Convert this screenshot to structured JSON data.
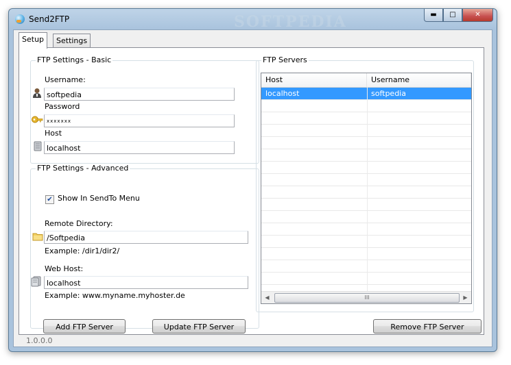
{
  "window": {
    "title": "Send2FTP",
    "minimize_glyph": "▬",
    "maximize_glyph": "□",
    "close_glyph": "✕",
    "watermark": "SOFTPEDIA"
  },
  "tabs": [
    {
      "label": "Setup",
      "active": true
    },
    {
      "label": "Settings",
      "active": false
    }
  ],
  "basic": {
    "group_title": "FTP Settings - Basic",
    "username_label": "Username:",
    "username_value": "softpedia",
    "password_label": "Password",
    "password_value": "xxxxxxx",
    "host_label": "Host",
    "host_value": "localhost"
  },
  "advanced": {
    "group_title": "FTP Settings - Advanced",
    "show_in_sendto_label": "Show In SendTo Menu",
    "show_in_sendto_checked": "✔",
    "remote_dir_label": "Remote Directory:",
    "remote_dir_value": "/Softpedia",
    "remote_dir_example": "Example: /dir1/dir2/",
    "web_host_label": "Web Host:",
    "web_host_value": "localhost",
    "web_host_example": "Example: www.myname.myhoster.de"
  },
  "servers": {
    "group_title": "FTP Servers",
    "columns": [
      "Host",
      "Username"
    ],
    "rows": [
      {
        "host": "localhost",
        "username": "softpedia",
        "selected": true
      }
    ],
    "scroll_left": "◀",
    "scroll_right": "▶",
    "scroll_grip": "III"
  },
  "buttons": {
    "add": "Add FTP Server",
    "update": "Update FTP Server",
    "remove": "Remove FTP Server"
  },
  "version": "1.0.0.0",
  "icons": {
    "app": "app-globe-icon",
    "username": "user-icon",
    "password": "key-icon",
    "host": "server-icon",
    "remote_dir": "folder-icon",
    "web_host": "server-icon"
  },
  "colors": {
    "selection": "#3399ff",
    "title_bar": "#a9c3dd",
    "close_button": "#c75050"
  }
}
